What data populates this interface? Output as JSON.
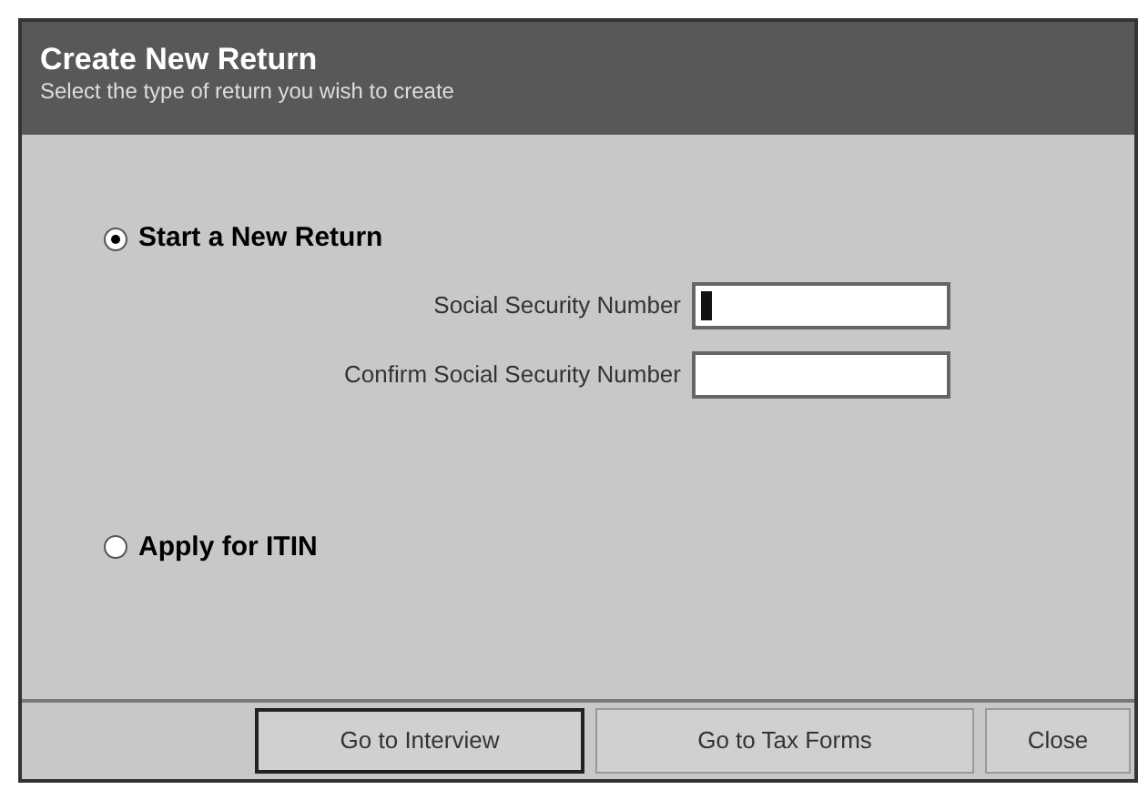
{
  "window": {
    "title": "Create New Return",
    "subtitle": "Select the type of return you wish to create"
  },
  "options": [
    {
      "label": "Start a New Return",
      "selected": true,
      "fields": [
        {
          "label": "Social Security Number",
          "focused": true
        },
        {
          "label": "Confirm Social Security Number",
          "focused": false
        }
      ]
    },
    {
      "label": "Apply for ITIN",
      "selected": false
    }
  ],
  "buttons": [
    {
      "label": "Go to Interview",
      "default": true
    },
    {
      "label": "Go to Tax Forms",
      "default": false
    },
    {
      "label": "Close",
      "default": false
    }
  ]
}
